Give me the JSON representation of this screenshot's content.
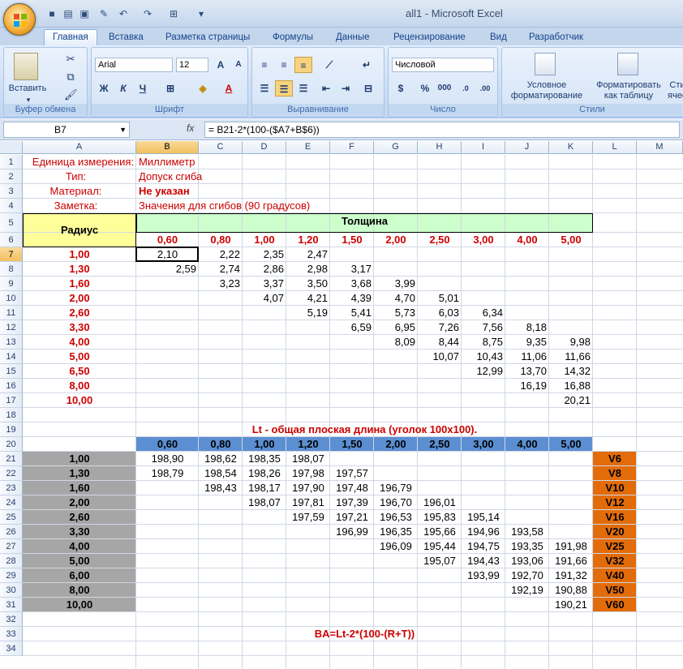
{
  "window": {
    "title": "all1 - Microsoft Excel"
  },
  "tabs": [
    "Главная",
    "Вставка",
    "Разметка страницы",
    "Формулы",
    "Данные",
    "Рецензирование",
    "Вид",
    "Разработчик"
  ],
  "ribbon": {
    "clipboard": {
      "label": "Буфер обмена",
      "paste": "Вставить"
    },
    "font": {
      "label": "Шрифт",
      "name": "Arial",
      "size": "12"
    },
    "alignment": {
      "label": "Выравнивание"
    },
    "number": {
      "label": "Число",
      "format": "Числовой"
    },
    "styles": {
      "label": "Стили",
      "cond_1": "Условное",
      "cond_2": "форматирование",
      "table_1": "Форматировать",
      "table_2": "как таблицу",
      "cell_1": "Сти",
      "cell_2": "ячее"
    }
  },
  "formula_bar": {
    "name_box": "B7",
    "fx": "fx",
    "formula": "= B21-2*(100-($A7+B$6))"
  },
  "columns": [
    "A",
    "B",
    "C",
    "D",
    "E",
    "F",
    "G",
    "H",
    "I",
    "J",
    "K",
    "L",
    "M"
  ],
  "rows": [
    "1",
    "2",
    "3",
    "4",
    "5",
    "6",
    "7",
    "8",
    "9",
    "10",
    "11",
    "12",
    "13",
    "14",
    "15",
    "16",
    "17",
    "18",
    "19",
    "20",
    "21",
    "22",
    "23",
    "24",
    "25",
    "26",
    "27",
    "28",
    "29",
    "30",
    "31",
    "32",
    "33",
    "34"
  ],
  "sheet": {
    "meta": [
      {
        "label": "Единица измерения:",
        "value": "Миллиметр",
        "value_bold": false
      },
      {
        "label": "Тип:",
        "value": "Допуск сгиба",
        "value_bold": false
      },
      {
        "label": "Материал:",
        "value": "Не указан",
        "value_bold": true
      },
      {
        "label": "Заметка:",
        "value": "Значения для сгибов (90 градусов)",
        "value_bold": false
      }
    ],
    "radius_header": "Радиус",
    "thickness_header": "Толщина",
    "thickness": [
      "0,60",
      "0,80",
      "1,00",
      "1,20",
      "1,50",
      "2,00",
      "2,50",
      "3,00",
      "4,00",
      "5,00"
    ],
    "radius": [
      "1,00",
      "1,30",
      "1,60",
      "2,00",
      "2,60",
      "3,30",
      "4,00",
      "5,00",
      "6,50",
      "8,00",
      "10,00"
    ],
    "ba_table": [
      [
        "2,10",
        "2,22",
        "2,35",
        "2,47",
        "",
        "",
        "",
        "",
        "",
        ""
      ],
      [
        "2,59",
        "2,74",
        "2,86",
        "2,98",
        "3,17",
        "",
        "",
        "",
        "",
        ""
      ],
      [
        "",
        "3,23",
        "3,37",
        "3,50",
        "3,68",
        "3,99",
        "",
        "",
        "",
        ""
      ],
      [
        "",
        "",
        "4,07",
        "4,21",
        "4,39",
        "4,70",
        "5,01",
        "",
        "",
        ""
      ],
      [
        "",
        "",
        "",
        "5,19",
        "5,41",
        "5,73",
        "6,03",
        "6,34",
        "",
        ""
      ],
      [
        "",
        "",
        "",
        "",
        "6,59",
        "6,95",
        "7,26",
        "7,56",
        "8,18",
        ""
      ],
      [
        "",
        "",
        "",
        "",
        "",
        "8,09",
        "8,44",
        "8,75",
        "9,35",
        "9,98"
      ],
      [
        "",
        "",
        "",
        "",
        "",
        "",
        "10,07",
        "10,43",
        "11,06",
        "11,66"
      ],
      [
        "",
        "",
        "",
        "",
        "",
        "",
        "",
        "12,99",
        "13,70",
        "14,32"
      ],
      [
        "",
        "",
        "",
        "",
        "",
        "",
        "",
        "",
        "16,19",
        "16,88"
      ],
      [
        "",
        "",
        "",
        "",
        "",
        "",
        "",
        "",
        "",
        "20,21"
      ]
    ],
    "lt_title": "Lt - общая плоская длина (уголок 100x100).",
    "lt_thickness": [
      "0,60",
      "0,80",
      "1,00",
      "1,20",
      "1,50",
      "2,00",
      "2,50",
      "3,00",
      "4,00",
      "5,00"
    ],
    "lt_radius": [
      "1,00",
      "1,30",
      "1,60",
      "2,00",
      "2,60",
      "3,30",
      "4,00",
      "5,00",
      "6,00",
      "8,00",
      "10,00"
    ],
    "lt_table": [
      [
        "198,90",
        "198,62",
        "198,35",
        "198,07",
        "",
        "",
        "",
        "",
        "",
        ""
      ],
      [
        "198,79",
        "198,54",
        "198,26",
        "197,98",
        "197,57",
        "",
        "",
        "",
        "",
        ""
      ],
      [
        "",
        "198,43",
        "198,17",
        "197,90",
        "197,48",
        "196,79",
        "",
        "",
        "",
        ""
      ],
      [
        "",
        "",
        "198,07",
        "197,81",
        "197,39",
        "196,70",
        "196,01",
        "",
        "",
        ""
      ],
      [
        "",
        "",
        "",
        "197,59",
        "197,21",
        "196,53",
        "195,83",
        "195,14",
        "",
        ""
      ],
      [
        "",
        "",
        "",
        "",
        "196,99",
        "196,35",
        "195,66",
        "194,96",
        "193,58",
        ""
      ],
      [
        "",
        "",
        "",
        "",
        "",
        "196,09",
        "195,44",
        "194,75",
        "193,35",
        "191,98"
      ],
      [
        "",
        "",
        "",
        "",
        "",
        "",
        "195,07",
        "194,43",
        "193,06",
        "191,66"
      ],
      [
        "",
        "",
        "",
        "",
        "",
        "",
        "",
        "193,99",
        "192,70",
        "191,32"
      ],
      [
        "",
        "",
        "",
        "",
        "",
        "",
        "",
        "",
        "192,19",
        "190,88"
      ],
      [
        "",
        "",
        "",
        "",
        "",
        "",
        "",
        "",
        "",
        "190,21"
      ]
    ],
    "v_labels": [
      "V6",
      "V8",
      "V10",
      "V12",
      "V16",
      "V20",
      "V25",
      "V32",
      "V40",
      "V50",
      "V60"
    ],
    "formula_note": "BA=Lt-2*(100-(R+T))"
  },
  "colors": {
    "accent_blue": "#5b8fd1",
    "yellow": "#ffff99",
    "light_green": "#ccffcc",
    "gray": "#a6a6a6",
    "orange": "#e36c0a",
    "red": "#cc0000"
  }
}
